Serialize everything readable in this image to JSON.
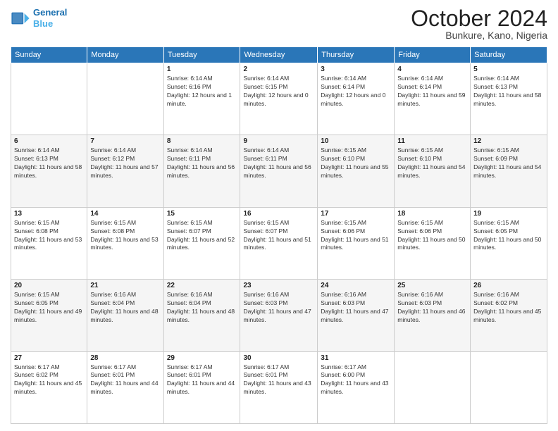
{
  "logo": {
    "line1": "General",
    "line2": "Blue"
  },
  "header": {
    "month": "October 2024",
    "location": "Bunkure, Kano, Nigeria"
  },
  "weekdays": [
    "Sunday",
    "Monday",
    "Tuesday",
    "Wednesday",
    "Thursday",
    "Friday",
    "Saturday"
  ],
  "weeks": [
    [
      {
        "day": "",
        "info": ""
      },
      {
        "day": "",
        "info": ""
      },
      {
        "day": "1",
        "info": "Sunrise: 6:14 AM\nSunset: 6:16 PM\nDaylight: 12 hours and 1 minute."
      },
      {
        "day": "2",
        "info": "Sunrise: 6:14 AM\nSunset: 6:15 PM\nDaylight: 12 hours and 0 minutes."
      },
      {
        "day": "3",
        "info": "Sunrise: 6:14 AM\nSunset: 6:14 PM\nDaylight: 12 hours and 0 minutes."
      },
      {
        "day": "4",
        "info": "Sunrise: 6:14 AM\nSunset: 6:14 PM\nDaylight: 11 hours and 59 minutes."
      },
      {
        "day": "5",
        "info": "Sunrise: 6:14 AM\nSunset: 6:13 PM\nDaylight: 11 hours and 58 minutes."
      }
    ],
    [
      {
        "day": "6",
        "info": "Sunrise: 6:14 AM\nSunset: 6:13 PM\nDaylight: 11 hours and 58 minutes."
      },
      {
        "day": "7",
        "info": "Sunrise: 6:14 AM\nSunset: 6:12 PM\nDaylight: 11 hours and 57 minutes."
      },
      {
        "day": "8",
        "info": "Sunrise: 6:14 AM\nSunset: 6:11 PM\nDaylight: 11 hours and 56 minutes."
      },
      {
        "day": "9",
        "info": "Sunrise: 6:14 AM\nSunset: 6:11 PM\nDaylight: 11 hours and 56 minutes."
      },
      {
        "day": "10",
        "info": "Sunrise: 6:15 AM\nSunset: 6:10 PM\nDaylight: 11 hours and 55 minutes."
      },
      {
        "day": "11",
        "info": "Sunrise: 6:15 AM\nSunset: 6:10 PM\nDaylight: 11 hours and 54 minutes."
      },
      {
        "day": "12",
        "info": "Sunrise: 6:15 AM\nSunset: 6:09 PM\nDaylight: 11 hours and 54 minutes."
      }
    ],
    [
      {
        "day": "13",
        "info": "Sunrise: 6:15 AM\nSunset: 6:08 PM\nDaylight: 11 hours and 53 minutes."
      },
      {
        "day": "14",
        "info": "Sunrise: 6:15 AM\nSunset: 6:08 PM\nDaylight: 11 hours and 53 minutes."
      },
      {
        "day": "15",
        "info": "Sunrise: 6:15 AM\nSunset: 6:07 PM\nDaylight: 11 hours and 52 minutes."
      },
      {
        "day": "16",
        "info": "Sunrise: 6:15 AM\nSunset: 6:07 PM\nDaylight: 11 hours and 51 minutes."
      },
      {
        "day": "17",
        "info": "Sunrise: 6:15 AM\nSunset: 6:06 PM\nDaylight: 11 hours and 51 minutes."
      },
      {
        "day": "18",
        "info": "Sunrise: 6:15 AM\nSunset: 6:06 PM\nDaylight: 11 hours and 50 minutes."
      },
      {
        "day": "19",
        "info": "Sunrise: 6:15 AM\nSunset: 6:05 PM\nDaylight: 11 hours and 50 minutes."
      }
    ],
    [
      {
        "day": "20",
        "info": "Sunrise: 6:15 AM\nSunset: 6:05 PM\nDaylight: 11 hours and 49 minutes."
      },
      {
        "day": "21",
        "info": "Sunrise: 6:16 AM\nSunset: 6:04 PM\nDaylight: 11 hours and 48 minutes."
      },
      {
        "day": "22",
        "info": "Sunrise: 6:16 AM\nSunset: 6:04 PM\nDaylight: 11 hours and 48 minutes."
      },
      {
        "day": "23",
        "info": "Sunrise: 6:16 AM\nSunset: 6:03 PM\nDaylight: 11 hours and 47 minutes."
      },
      {
        "day": "24",
        "info": "Sunrise: 6:16 AM\nSunset: 6:03 PM\nDaylight: 11 hours and 47 minutes."
      },
      {
        "day": "25",
        "info": "Sunrise: 6:16 AM\nSunset: 6:03 PM\nDaylight: 11 hours and 46 minutes."
      },
      {
        "day": "26",
        "info": "Sunrise: 6:16 AM\nSunset: 6:02 PM\nDaylight: 11 hours and 45 minutes."
      }
    ],
    [
      {
        "day": "27",
        "info": "Sunrise: 6:17 AM\nSunset: 6:02 PM\nDaylight: 11 hours and 45 minutes."
      },
      {
        "day": "28",
        "info": "Sunrise: 6:17 AM\nSunset: 6:01 PM\nDaylight: 11 hours and 44 minutes."
      },
      {
        "day": "29",
        "info": "Sunrise: 6:17 AM\nSunset: 6:01 PM\nDaylight: 11 hours and 44 minutes."
      },
      {
        "day": "30",
        "info": "Sunrise: 6:17 AM\nSunset: 6:01 PM\nDaylight: 11 hours and 43 minutes."
      },
      {
        "day": "31",
        "info": "Sunrise: 6:17 AM\nSunset: 6:00 PM\nDaylight: 11 hours and 43 minutes."
      },
      {
        "day": "",
        "info": ""
      },
      {
        "day": "",
        "info": ""
      }
    ]
  ]
}
